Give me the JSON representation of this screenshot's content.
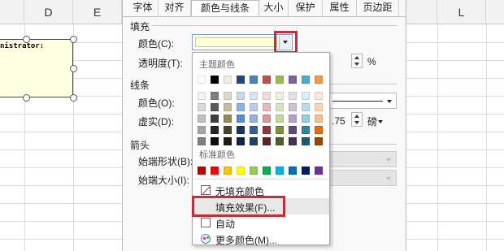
{
  "sheet": {
    "columns": [
      "D",
      "E",
      "L"
    ],
    "comment_text": "nistrator:"
  },
  "dialog": {
    "tabs": [
      "字体",
      "对齐",
      "颜色与线条",
      "大小",
      "保护",
      "属性",
      "页边距"
    ],
    "active_tab": "颜色与线条",
    "fill": {
      "section_label": "填充",
      "color_label": "颜色(C):",
      "color_value": "#FFFFD6",
      "transparency_label": "透明度(T):",
      "transparency_unit": "%"
    },
    "line": {
      "section_label": "线条",
      "color_label": "颜色(O):",
      "dash_label": "虚实(D):",
      "weight_value": ".75",
      "weight_unit": "磅"
    },
    "arrows": {
      "section_label": "箭头",
      "begin_style_label": "始端形状(B):",
      "begin_size_label": "始端大小(I):"
    }
  },
  "color_dropdown": {
    "theme_title": "主题颜色",
    "standard_title": "标准颜色",
    "theme_colors": [
      "#FFFFFF",
      "#000000",
      "#EEECE1",
      "#1F497D",
      "#4F81BD",
      "#C0504D",
      "#9BBB59",
      "#8064A2",
      "#4BACC6",
      "#F79646"
    ],
    "theme_shades": [
      [
        "#F2F2F2",
        "#7F7F7F",
        "#DDD9C3",
        "#C6D9F0",
        "#DBE5F1",
        "#F2DCDB",
        "#EBF1DD",
        "#E5E0EC",
        "#DBEEF3",
        "#FDEADA"
      ],
      [
        "#D8D8D8",
        "#595959",
        "#C4BD97",
        "#8DB3E2",
        "#B8CCE4",
        "#E5B9B7",
        "#D7E3BC",
        "#CCC1D9",
        "#B7DDE8",
        "#FBD5B5"
      ],
      [
        "#BFBFBF",
        "#3F3F3F",
        "#938953",
        "#548DD4",
        "#95B3D7",
        "#D99694",
        "#C3D69B",
        "#B2A2C7",
        "#92CDDC",
        "#FAC08F"
      ],
      [
        "#A5A5A5",
        "#262626",
        "#494429",
        "#17365D",
        "#366092",
        "#953734",
        "#76923C",
        "#5F497A",
        "#31859B",
        "#E36C09"
      ],
      [
        "#7F7F7F",
        "#0C0C0C",
        "#1D1B10",
        "#0F243E",
        "#244061",
        "#632423",
        "#4F6128",
        "#3F3151",
        "#205867",
        "#974806"
      ]
    ],
    "standard_colors": [
      "#C00000",
      "#FF0000",
      "#FFC000",
      "#FFFF00",
      "#92D050",
      "#00B050",
      "#00B0F0",
      "#0070C0",
      "#002060",
      "#7030A0"
    ],
    "no_fill_label": "无填充颜色",
    "fill_effects_label": "填充效果(F)...",
    "automatic_label": "自动",
    "more_colors_label": "更多颜色(M)..."
  }
}
